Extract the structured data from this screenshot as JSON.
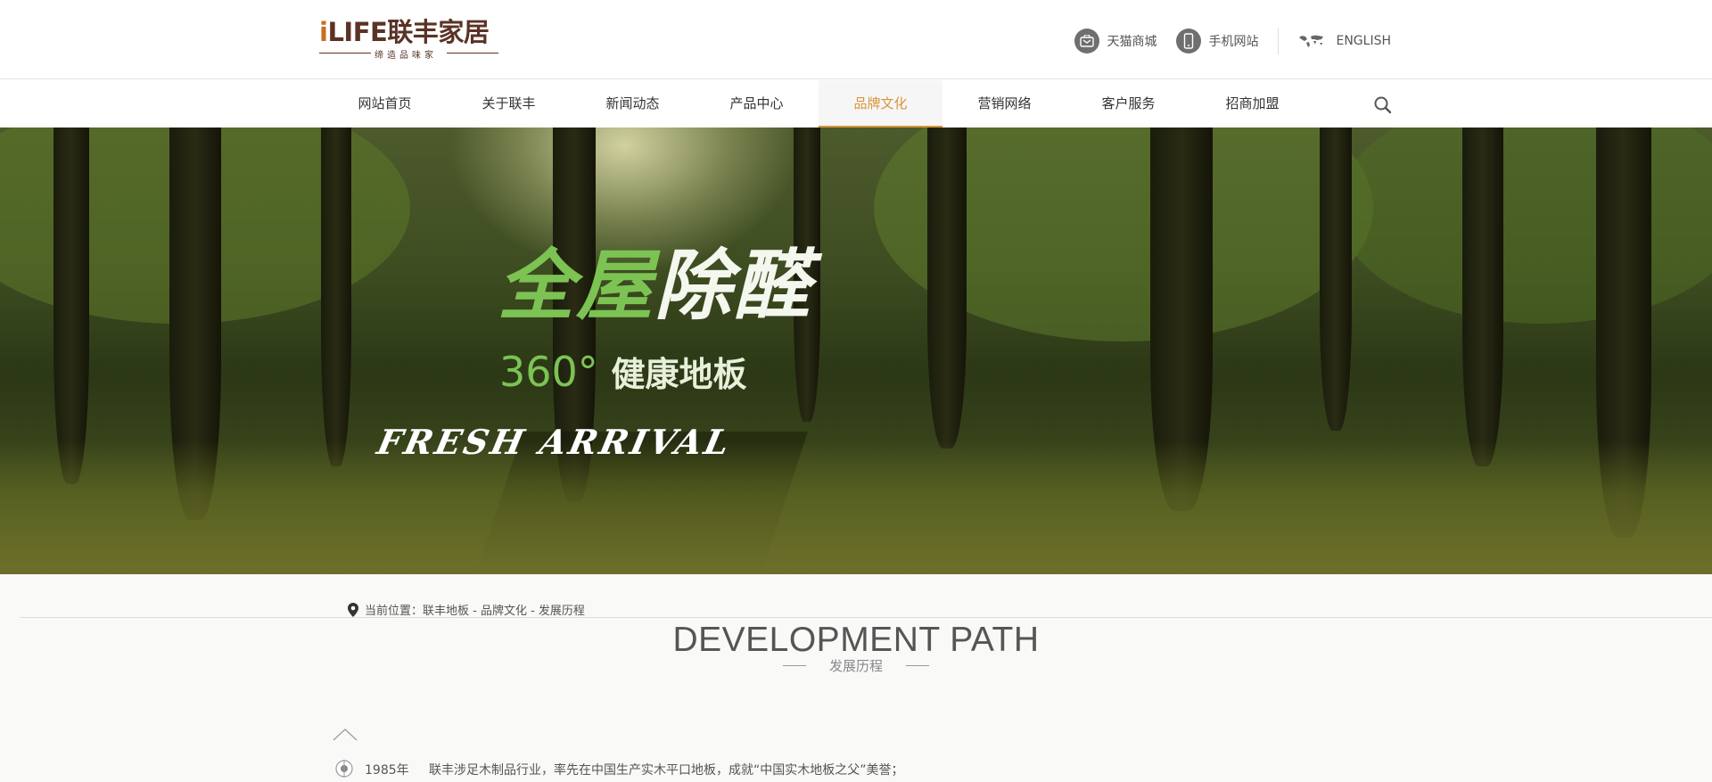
{
  "header": {
    "logo": {
      "brand": "LIFE",
      "brand_cn": "联丰家居",
      "slogan": "缔造品味家"
    },
    "links": [
      {
        "label": "天猫商城",
        "icon": "shop-bag-icon"
      },
      {
        "label": "手机网站",
        "icon": "mobile-phone-icon"
      },
      {
        "label": "ENGLISH",
        "icon": "world-map-icon"
      }
    ]
  },
  "nav": {
    "items": [
      {
        "label": "网站首页"
      },
      {
        "label": "关于联丰"
      },
      {
        "label": "新闻动态"
      },
      {
        "label": "产品中心"
      },
      {
        "label": "品牌文化",
        "active": true
      },
      {
        "label": "营销网络"
      },
      {
        "label": "客户服务"
      },
      {
        "label": "招商加盟"
      }
    ],
    "search_icon": "search-icon",
    "active_color": "#d9953a"
  },
  "banner": {
    "title_green": "全屋",
    "title_white": "除醛",
    "sub_green": "360°",
    "sub_white": "健康地板",
    "tagline": "FRESH ARRIVAL",
    "accent_color": "#7cc354"
  },
  "breadcrumb": {
    "prefix": "当前位置：",
    "path": "联丰地板 - 品牌文化 - 发展历程"
  },
  "section": {
    "title": "DEVELOPMENT PATH",
    "subtitle": "发展历程"
  },
  "timeline": [
    {
      "year": "1985年",
      "text": "联丰涉足木制品行业，率先在中国生产实木平口地板，成就“中国实木地板之父”美誉；"
    }
  ]
}
